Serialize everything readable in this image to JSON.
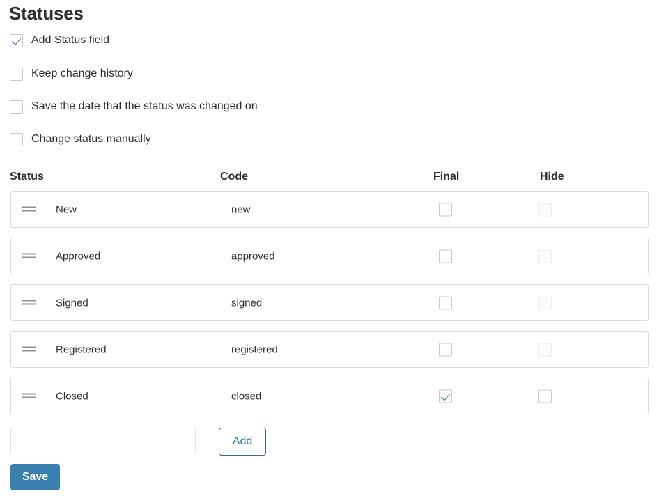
{
  "page": {
    "title": "Statuses"
  },
  "options": [
    {
      "label": "Add Status field",
      "checked": true,
      "disabled": false
    },
    {
      "label": "Keep change history",
      "checked": false,
      "disabled": false
    },
    {
      "label": "Save the date that the status was changed on",
      "checked": false,
      "disabled": false
    },
    {
      "label": "Change status manually",
      "checked": false,
      "disabled": false
    }
  ],
  "table": {
    "headers": {
      "status": "Status",
      "code": "Code",
      "final": "Final",
      "hide": "Hide"
    },
    "rows": [
      {
        "handle_icon": "drag-handle-icon",
        "status": "New",
        "code": "new",
        "final_checked": false,
        "final_disabled": false,
        "hide_checked": false,
        "hide_disabled": true
      },
      {
        "handle_icon": "drag-handle-icon",
        "status": "Approved",
        "code": "approved",
        "final_checked": false,
        "final_disabled": false,
        "hide_checked": false,
        "hide_disabled": true
      },
      {
        "handle_icon": "drag-handle-icon",
        "status": "Signed",
        "code": "signed",
        "final_checked": false,
        "final_disabled": false,
        "hide_checked": false,
        "hide_disabled": true
      },
      {
        "handle_icon": "drag-handle-icon",
        "status": "Registered",
        "code": "registered",
        "final_checked": false,
        "final_disabled": false,
        "hide_checked": false,
        "hide_disabled": true
      },
      {
        "handle_icon": "drag-handle-icon",
        "status": "Closed",
        "code": "closed",
        "final_checked": true,
        "final_disabled": false,
        "hide_checked": false,
        "hide_disabled": false
      }
    ]
  },
  "add_row": {
    "input_value": "",
    "input_placeholder": "",
    "add_label": "Add"
  },
  "footer": {
    "save_label": "Save"
  },
  "colors": {
    "accent_blue": "#2f6fa8",
    "save_button_bg": "#3a80ae",
    "text": "#2e2e2e",
    "border": "#dcdcdc",
    "checkbox_border": "#c8cbcd",
    "checkbox_disabled_border": "#ececec"
  }
}
